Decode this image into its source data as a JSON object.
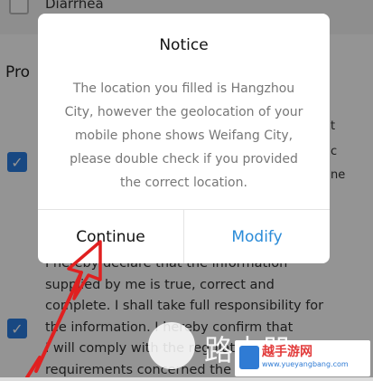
{
  "background": {
    "top_item": "Diarrhea",
    "section_title": "Pro",
    "side_fragments": [
      "t",
      "c",
      "ne"
    ],
    "paragraph_lines": [
      "I hereby declare that the information",
      "supplied by me is true, correct and",
      "complete. I shall take full responsibility for",
      "the information. I hereby confirm that",
      "I will comply with the regulations",
      "requirements concerned the"
    ]
  },
  "dialog": {
    "title": "Notice",
    "message_lines": [
      "The location you filled is Hangzhou",
      "City, however the geolocation of your",
      "mobile phone shows Weifang City,",
      "please double check if you provided",
      "the correct location."
    ],
    "continue_label": "Continue",
    "modify_label": "Modify"
  },
  "watermark": {
    "chinese_text": "路由器",
    "badge_text": "越手游网",
    "badge_url": "www.yueyangbang.com"
  },
  "colors": {
    "accent_blue": "#2a8bd8",
    "checkbox_blue": "#2a7de1",
    "annotation_red": "#e02020"
  }
}
